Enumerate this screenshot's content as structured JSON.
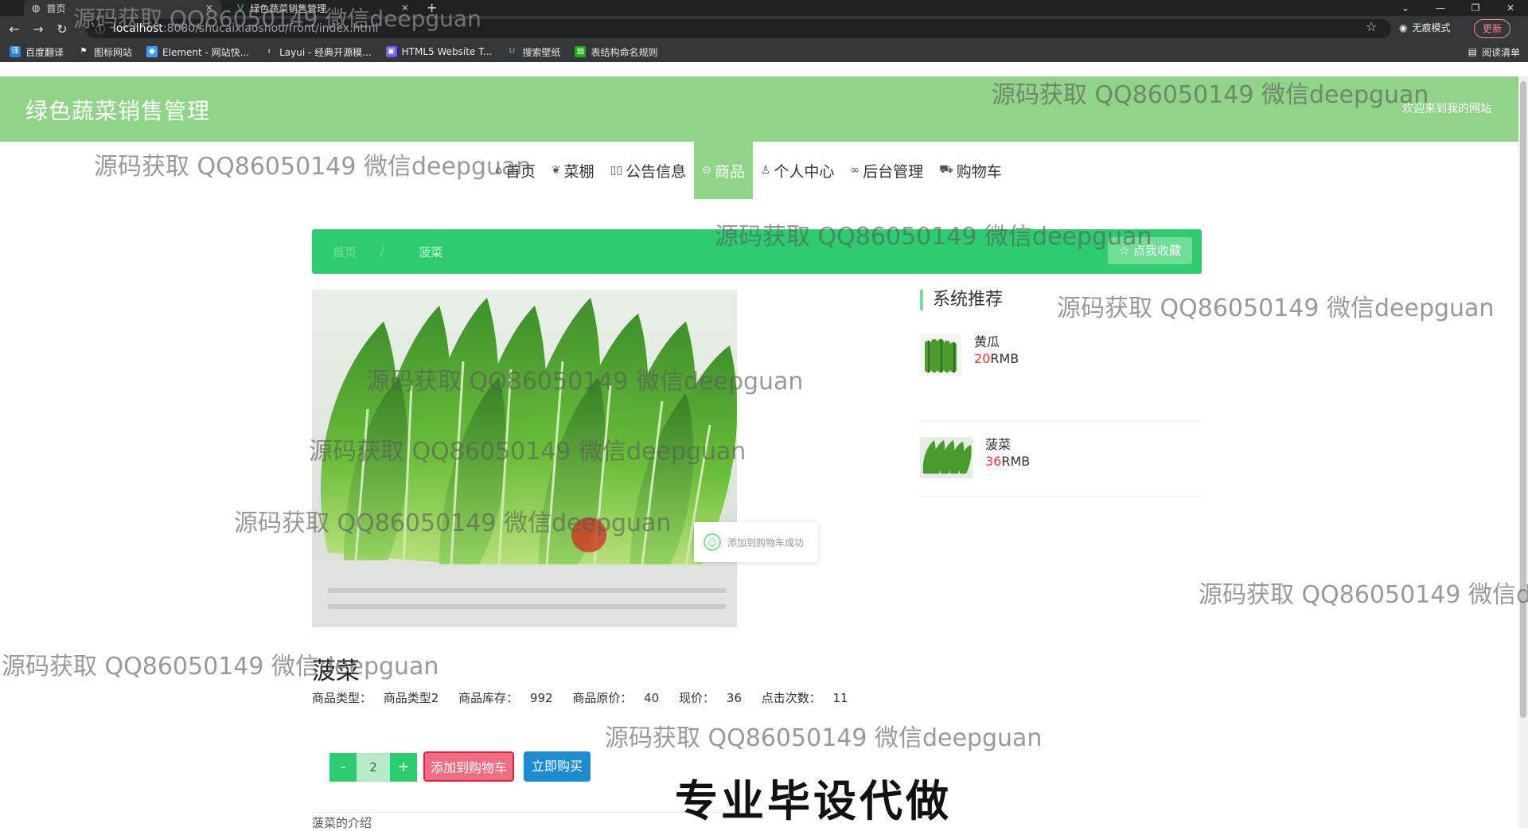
{
  "browser": {
    "tabs": [
      {
        "title": "首页",
        "active": true
      },
      {
        "title": "绿色蔬菜销售管理",
        "active": false
      }
    ],
    "url_host": "localhost",
    "url_path": ":8080/shucaixiaoshou/front/index.html",
    "incognito_label": "无痕模式",
    "update_label": "更新",
    "bookmarks": [
      "百度翻译",
      "图标网站",
      "Element - 网站快...",
      "Layui - 经典开源模...",
      "HTML5 Website T...",
      "搜索壁纸",
      "表结构命名规则"
    ],
    "reading_list": "阅读清单"
  },
  "site": {
    "title": "绿色蔬菜销售管理",
    "welcome": "欢迎来到我的网站"
  },
  "nav": [
    {
      "label": "首页",
      "icon": "home-icon",
      "glyph": "⌂"
    },
    {
      "label": "菜棚",
      "icon": "leaf-icon",
      "glyph": "❦"
    },
    {
      "label": "公告信息",
      "icon": "news-icon",
      "glyph": "▯▯"
    },
    {
      "label": "商品",
      "icon": "goods-icon",
      "glyph": "⊖",
      "active": true
    },
    {
      "label": "个人中心",
      "icon": "user-icon",
      "glyph": "♙"
    },
    {
      "label": "后台管理",
      "icon": "link-icon",
      "glyph": "∞"
    },
    {
      "label": "购物车",
      "icon": "cart-icon",
      "glyph": "⛟"
    }
  ],
  "breadcrumb": {
    "home": "首页",
    "sep": "/",
    "current": "菠菜"
  },
  "favorite_label": "☆ 点我收藏",
  "toast": "添加到购物车成功",
  "recommend": {
    "title": "系统推荐",
    "items": [
      {
        "name": "黄瓜",
        "price": "20",
        "unit": "RMB"
      },
      {
        "name": "菠菜",
        "price": "36",
        "unit": "RMB"
      }
    ]
  },
  "product": {
    "name": "菠菜",
    "type_label": "商品类型：",
    "type": "商品类型2",
    "stock_label": "商品库存：",
    "stock": "992",
    "orig_label": "商品原价：",
    "orig_price": "40",
    "cur_label": "现价：",
    "cur_price": "36",
    "clicks_label": "点击次数：",
    "clicks": "11",
    "qty": "2",
    "minus": "-",
    "plus": "+",
    "add_cart": "添加到购物车",
    "buy_now": "立即购买",
    "intro": "菠菜的介绍"
  },
  "promo": "专业毕设代做",
  "watermark": "源码获取 QQ86050149 微信deepguan",
  "colors": {
    "header": "#92d38a",
    "crumb": "#2ecc71",
    "price": "#e8403b",
    "buy": "#1f8bcf"
  }
}
